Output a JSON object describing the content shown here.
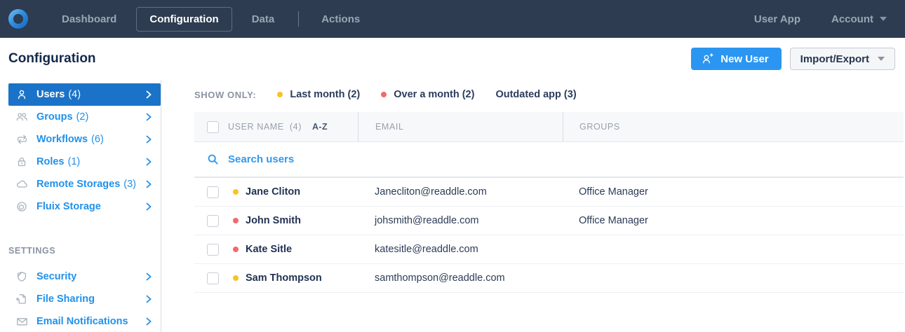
{
  "topbar": {
    "nav": [
      {
        "label": "Dashboard"
      },
      {
        "label": "Configuration"
      },
      {
        "label": "Data"
      },
      {
        "label": "Actions"
      }
    ],
    "user_app_label": "User App",
    "account_label": "Account"
  },
  "page": {
    "title": "Configuration"
  },
  "toolbar": {
    "new_user_label": "New User",
    "import_export_label": "Import/Export"
  },
  "sidebar": {
    "items": [
      {
        "label": "Users",
        "count": "(4)",
        "icon": "user-icon",
        "active": true
      },
      {
        "label": "Groups",
        "count": "(2)",
        "icon": "group-icon",
        "active": false
      },
      {
        "label": "Workflows",
        "count": "(6)",
        "icon": "workflow-icon",
        "active": false
      },
      {
        "label": "Roles",
        "count": "(1)",
        "icon": "lock-icon",
        "active": false
      },
      {
        "label": "Remote Storages",
        "count": "(3)",
        "icon": "cloud-icon",
        "active": false
      },
      {
        "label": "Fluix Storage",
        "count": "",
        "icon": "fluix-ring-icon",
        "active": false
      }
    ],
    "settings_label": "SETTINGS",
    "settings_items": [
      {
        "label": "Security",
        "icon": "shield-icon"
      },
      {
        "label": "File Sharing",
        "icon": "file-upload-icon"
      },
      {
        "label": "Email Notifications",
        "icon": "envelope-icon"
      }
    ]
  },
  "filters": {
    "label": "SHOW ONLY:",
    "items": [
      {
        "label": "Last month (2)",
        "dot_color": "#f7c325"
      },
      {
        "label": "Over a month (2)",
        "dot_color": "#ee6b6e"
      },
      {
        "label": "Outdated app (3)",
        "dot_color": ""
      }
    ]
  },
  "table": {
    "columns": {
      "user_name": "USER NAME",
      "user_name_count": "(4)",
      "sort": "A-Z",
      "email": "EMAIL",
      "groups": "GROUPS"
    },
    "search_placeholder": "Search users",
    "rows": [
      {
        "name": "Jane Cliton",
        "dot_color": "#f7c325",
        "email": "Janecliton@readdle.com",
        "groups": "Office Manager"
      },
      {
        "name": "John Smith",
        "dot_color": "#ee6b6e",
        "email": "johsmith@readdle.com",
        "groups": "Office Manager"
      },
      {
        "name": "Kate Sitle",
        "dot_color": "#ee6b6e",
        "email": "katesitle@readdle.com",
        "groups": ""
      },
      {
        "name": "Sam Thompson",
        "dot_color": "#f7c325",
        "email": "samthompson@readdle.com",
        "groups": ""
      }
    ]
  },
  "colors": {
    "topbar_bg": "#2d3c50",
    "accent_blue": "#2191eb",
    "active_item_bg": "#1a73c8",
    "primary_button": "#2b96f1",
    "dot_yellow": "#f7c325",
    "dot_red": "#ee6b6e"
  }
}
